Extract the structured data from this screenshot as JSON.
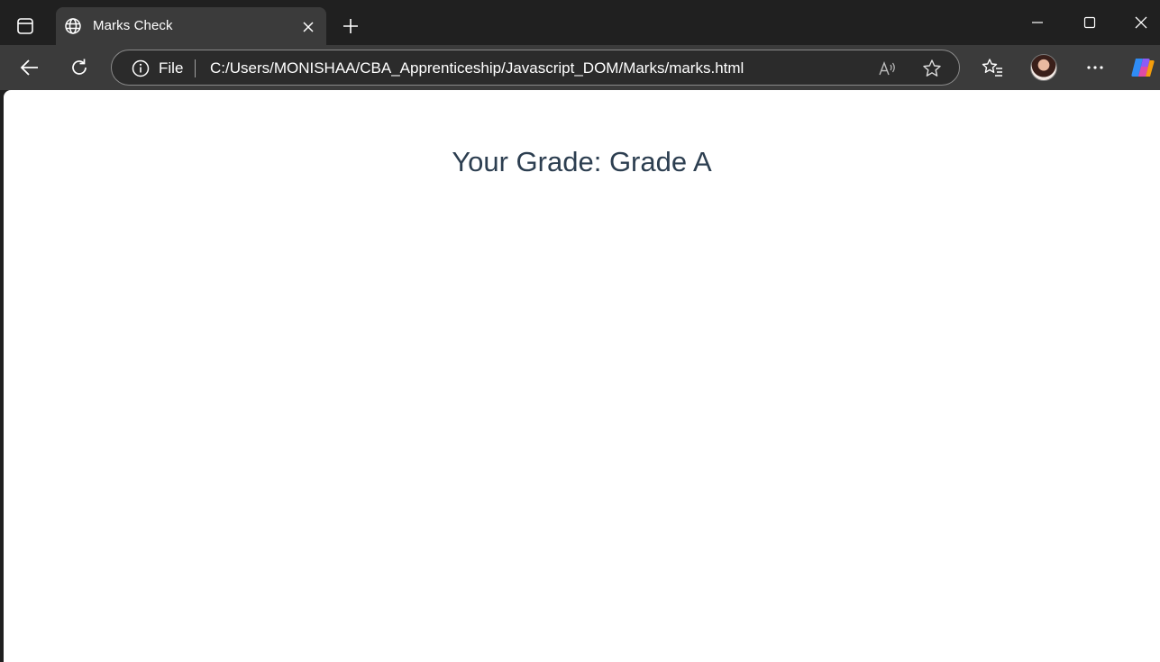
{
  "browser": {
    "tab": {
      "title": "Marks Check"
    },
    "address": {
      "site_label": "File",
      "url": "C:/Users/MONISHAA/CBA_Apprenticeship/Javascript_DOM/Marks/marks.html"
    },
    "icons": {
      "sidebar": "tab-actions-icon",
      "tab_favicon": "globe-icon",
      "tab_close": "close-icon",
      "new_tab": "plus-icon",
      "back": "back-arrow-icon",
      "refresh": "refresh-icon",
      "info": "info-icon",
      "read_aloud": "read-aloud-icon",
      "favorite": "star-icon",
      "favorites": "favorites-icon",
      "profile": "avatar",
      "more": "more-icon",
      "copilot": "copilot-icon",
      "minimize": "minimize-icon",
      "maximize": "maximize-icon",
      "close_window": "close-window-icon"
    }
  },
  "page": {
    "grade_text": "Your Grade: Grade A",
    "text_color": "#2c3e50"
  }
}
